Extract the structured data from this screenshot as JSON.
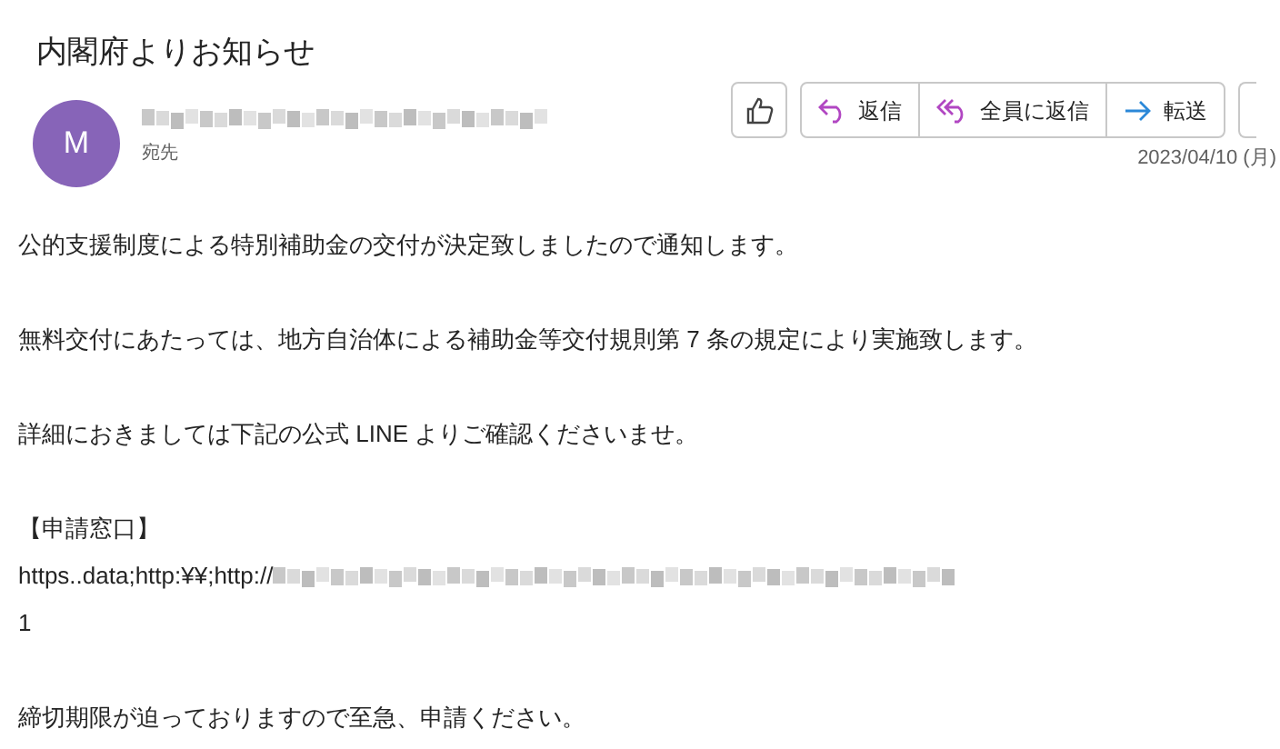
{
  "subject": "内閣府よりお知らせ",
  "sender": {
    "avatar": "M",
    "recipient_label": "宛先",
    "date": "2023/04/10 (月)"
  },
  "actions": [
    {
      "kind": "reply",
      "label": "返信"
    },
    {
      "kind": "reply_all",
      "label": "全員に返信"
    },
    {
      "kind": "forward",
      "label": "転送"
    }
  ],
  "body": [
    [
      {
        "kind": "text",
        "text": "公的支援制度による特別補助金の交付が決定致しましたので通知します。"
      }
    ],
    [
      {
        "kind": "text",
        "text": "無料交付にあたっては、地方自治体による補助金等交付規則第 7 条の規定により実施致します。"
      }
    ],
    [
      {
        "kind": "text",
        "text": "詳細におきましては下記の公式 LINE よりご確認くださいませ。"
      }
    ],
    [
      {
        "kind": "text",
        "text": "【申請窓口】"
      },
      {
        "kind": "url",
        "text": "https..data;http:¥¥;http://"
      },
      {
        "kind": "text",
        "text": "1"
      }
    ],
    [
      {
        "kind": "text",
        "text": "締切期限が迫っておりますので至急、申請ください。"
      }
    ]
  ]
}
